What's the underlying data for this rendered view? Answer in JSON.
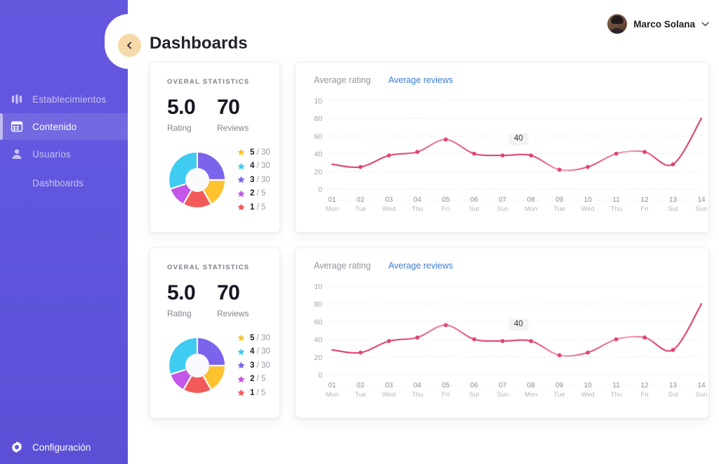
{
  "sidebar": {
    "items": [
      {
        "label": "Establecimientos",
        "icon": "bar-chart-icon",
        "active": false
      },
      {
        "label": "Contenido",
        "icon": "grid-table-icon",
        "active": true
      },
      {
        "label": "Usuarios",
        "icon": "user-icon",
        "active": false
      }
    ],
    "sub_item": {
      "label": "Dashboards"
    },
    "settings": {
      "label": "Configuración",
      "icon": "gear-icon"
    }
  },
  "header": {
    "title": "Dashboards",
    "collapse_icon": "chevron-left-icon",
    "user": {
      "name": "Marco Solana",
      "chevron": "chevron-down-icon"
    }
  },
  "stats_card": {
    "kicker": "OVERAL STATISTICS",
    "rating": {
      "value": "5.0",
      "caption": "Rating"
    },
    "reviews": {
      "value": "70",
      "caption": "Reviews"
    },
    "legend": [
      {
        "stars": "5",
        "sep": "/",
        "total": "30",
        "color": "#FDC22D"
      },
      {
        "stars": "4",
        "sep": "/",
        "total": "30",
        "color": "#40CBF0"
      },
      {
        "stars": "3",
        "sep": "/",
        "total": "30",
        "color": "#7C63EC"
      },
      {
        "stars": "2",
        "sep": "/",
        "total": "5",
        "color": "#C champion"
      },
      {
        "stars": "1",
        "sep": "/",
        "total": "5",
        "color": "#F25A5A"
      }
    ],
    "donut_colors": [
      "#7C63EC",
      "#FDC22D",
      "#F25A5A",
      "#C457E8",
      "#40CBF0"
    ]
  },
  "chart_card": {
    "tabs": [
      {
        "label": "Average rating",
        "active": false
      },
      {
        "label": "Average reviews",
        "active": true
      }
    ],
    "tooltip": "40"
  },
  "chart_data": {
    "type": "line",
    "title": "Average reviews",
    "xlabel": "",
    "ylabel": "",
    "ylim": [
      0,
      100
    ],
    "yticks": [
      "0",
      "20",
      "40",
      "60",
      "80",
      "10"
    ],
    "grid": true,
    "line_color": "#E0466E",
    "categories": [
      "01",
      "02",
      "03",
      "04",
      "05",
      "06",
      "07",
      "08",
      "09",
      "10",
      "11",
      "12",
      "13",
      "14"
    ],
    "sublabels": [
      "Mon",
      "Tue",
      "Wed",
      "Thu",
      "Fri",
      "Sut",
      "Sun",
      "Mon",
      "Tue",
      "Wed",
      "Thu",
      "Fri",
      "Sut",
      "Sun"
    ],
    "series": [
      {
        "name": "Average reviews",
        "values": [
          28,
          25,
          38,
          42,
          56,
          40,
          38,
          38,
          22,
          25,
          40,
          42,
          28,
          80
        ]
      }
    ],
    "annotation": {
      "label": "40",
      "at_category": "08"
    }
  },
  "cards": [
    {
      "id": "card-set-1"
    },
    {
      "id": "card-set-2"
    }
  ]
}
